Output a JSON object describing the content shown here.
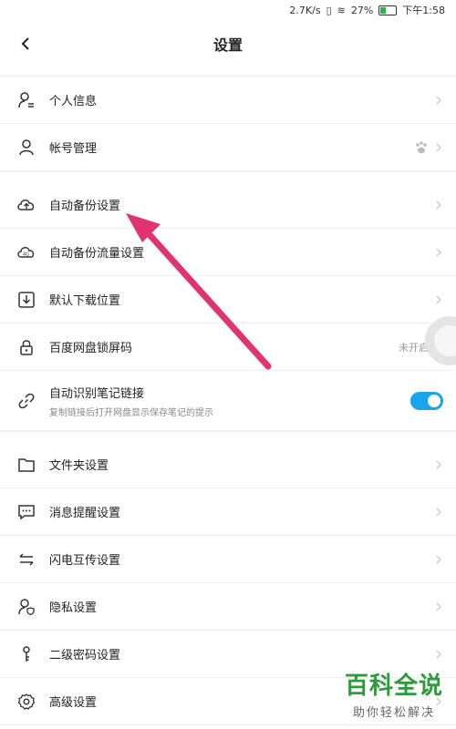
{
  "status_bar": {
    "speed": "2.7K/s",
    "battery": "27%",
    "time": "下午1:58"
  },
  "header": {
    "title": "设置"
  },
  "groups": [
    [
      {
        "label": "个人信息",
        "icon": "user-card-icon"
      },
      {
        "label": "帐号管理",
        "icon": "user-icon",
        "right_icon": "baidu-paw-icon"
      }
    ],
    [
      {
        "label": "自动备份设置",
        "icon": "cloud-upload-icon"
      },
      {
        "label": "自动备份流量设置",
        "icon": "cloud-4g-icon"
      },
      {
        "label": "默认下载位置",
        "icon": "download-box-icon"
      },
      {
        "label": "百度网盘锁屏码",
        "icon": "lock-icon",
        "right_text": "未开启"
      },
      {
        "label": "自动识别笔记链接",
        "sub": "复制链接后打开网盘显示保存笔记的提示",
        "icon": "link-icon",
        "toggle_on": true
      }
    ],
    [
      {
        "label": "文件夹设置",
        "icon": "folder-icon"
      },
      {
        "label": "消息提醒设置",
        "icon": "message-icon"
      },
      {
        "label": "闪电互传设置",
        "icon": "transfer-arrows-icon"
      },
      {
        "label": "隐私设置",
        "icon": "privacy-user-icon"
      },
      {
        "label": "二级密码设置",
        "icon": "key-icon"
      },
      {
        "label": "高级设置",
        "icon": "gear-icon"
      }
    ]
  ],
  "watermark": {
    "main": "百科全说",
    "sub": "助你轻松解决"
  },
  "colors": {
    "accent": "#1aa4f0",
    "annotation_arrow": "#e0336f",
    "watermark": "#2f9a3a"
  }
}
